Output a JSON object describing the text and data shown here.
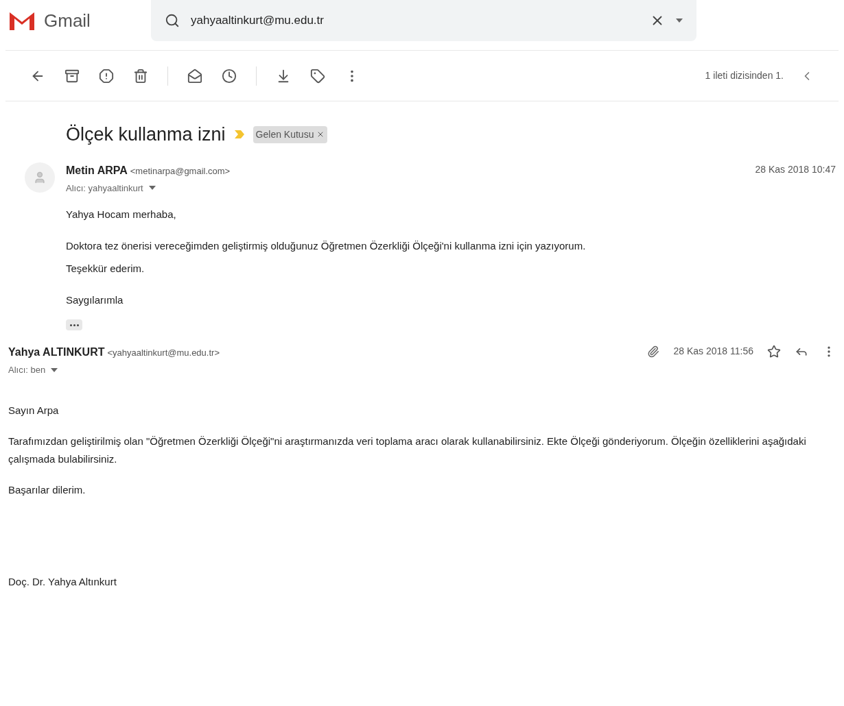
{
  "header": {
    "app_name": "Gmail",
    "search": {
      "value": "yahyaaltinkurt@mu.edu.tr"
    }
  },
  "toolbar": {
    "pagination": "1 ileti dizisinden 1."
  },
  "subject": "Ölçek kullanma izni",
  "label": "Gelen Kutusu",
  "messages": [
    {
      "kind": "indented",
      "sender": "Metin ARPA",
      "email": "<metinarpa@gmail.com>",
      "to": "Alıcı: yahyaaltinkurt",
      "date": "28 Kas 2018 10:47",
      "has_attachment": false,
      "paragraphs": [
        [
          "Yahya Hocam merhaba,"
        ],
        [
          "Doktora tez önerisi vereceğimden geliştirmiş olduğunuz  Öğretmen Özerkliği Ölçeği'ni kullanma izni için yazıyorum.",
          "Teşekkür ederim."
        ],
        [
          "Saygılarımla"
        ]
      ]
    },
    {
      "kind": "full",
      "sender": "Yahya ALTINKURT",
      "email": "<yahyaaltinkurt@mu.edu.tr>",
      "to": "Alıcı: ben",
      "date": "28 Kas 2018 11:56",
      "has_attachment": true,
      "paragraphs": [
        [
          "Sayın Arpa"
        ],
        [
          "Tarafımızdan geliştirilmiş olan \"Öğretmen Özerkliği Ölçeği\"ni araştırmanızda veri toplama aracı olarak kullanabilirsiniz. Ekte Ölçeği gönderiyorum. Ölçeğin özelliklerini aşağıdaki çalışmada bulabilirsiniz."
        ],
        [
          "Başarılar dilerim."
        ]
      ],
      "signature": "Doç. Dr. Yahya Altınkurt"
    }
  ]
}
